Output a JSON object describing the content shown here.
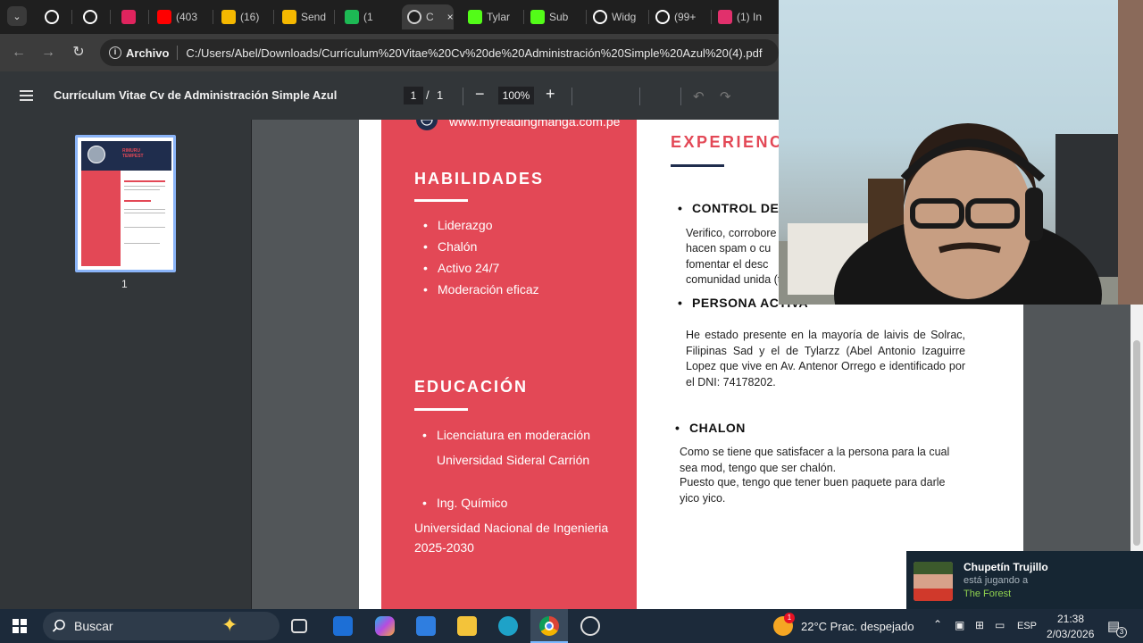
{
  "browser": {
    "tabs": [
      {
        "label": "",
        "icon": "github-icon",
        "color": "#ffffff"
      },
      {
        "label": "",
        "icon": "github-icon",
        "color": "#ffffff"
      },
      {
        "label": "",
        "icon": "app-icon",
        "color": "#e0245e"
      },
      {
        "label": "(403",
        "icon": "youtube-icon",
        "color": "#ff0000"
      },
      {
        "label": "(16)",
        "icon": "hand-icon",
        "color": "#f5b800"
      },
      {
        "label": "Send",
        "icon": "hand-icon",
        "color": "#f5b800"
      },
      {
        "label": "(1",
        "icon": "app-icon",
        "color": "#1db954"
      },
      {
        "label": "C",
        "icon": "chrome-icon",
        "color": "#cfcfcf"
      },
      {
        "label": "Tylar",
        "icon": "kick-icon",
        "color": "#53fc18"
      },
      {
        "label": "Sub",
        "icon": "kick-icon",
        "color": "#53fc18"
      },
      {
        "label": "Widg",
        "icon": "diamond-icon",
        "color": "#ffffff"
      },
      {
        "label": "(99+",
        "icon": "tiktok-icon",
        "color": "#ffffff"
      },
      {
        "label": "(1) In",
        "icon": "instagram-icon",
        "color": "#e1306c"
      }
    ],
    "omnibox_chip": "Archivo",
    "url": "C:/Users/Abel/Downloads/Currículum%20Vitae%20Cv%20de%20Administración%20Simple%20Azul%20(4).pdf"
  },
  "pdf_toolbar": {
    "title": "Currículum Vitae Cv de Administración Simple Azul",
    "page_current": "1",
    "page_sep": "/",
    "page_total": "1",
    "zoom": "100%",
    "zoom_out": "−",
    "zoom_in": "+"
  },
  "sidebar": {
    "thumb_name": "RIMURU TEMPEST",
    "thumb_page": "1"
  },
  "resume": {
    "website": "www.myreadingmanga.com.pe",
    "skills_heading": "HABILIDADES",
    "skills": [
      "Liderazgo",
      "Chalón",
      "Activo 24/7",
      "Moderación eficaz"
    ],
    "education_heading": "EDUCACIÓN",
    "edu1_title": "Licenciatura en moderación",
    "edu1_school": "Universidad Sideral Carrión",
    "edu2_title": "Ing. Químico",
    "edu2_school": "Universidad Nacional de Ingenieria",
    "edu2_years": "2025-2030",
    "experience_heading": "EXPERIENC",
    "exp1_title": "CONTROL DE",
    "exp1_lines": [
      "Verifico, corrobore",
      "hacen spam o cu",
      "fomentar el desc",
      "comunidad unida (t"
    ],
    "exp2_title": "PERSONA ACTIVA",
    "exp2_text": "He estado presente en la mayoría de laivis de Solrac, Filipinas Sad y el de Tylarzz (Abel Antonio Izaguirre Lopez que vive en Av. Antenor Orrego e identificado por el DNI: 74178202.",
    "exp3_title": "CHALON",
    "exp3_text1": "Como se tiene que satisfacer a la persona para la cual sea mod, tengo que ser chalón.",
    "exp3_text2": "Puesto que, tengo que tener buen paquete para darle yico yico."
  },
  "notification": {
    "name": "Chupetín Trujillo",
    "status": "está jugando a",
    "game": "The Forest"
  },
  "taskbar": {
    "search_label": "Buscar",
    "weather_badge": "1",
    "weather": "22°C  Prac. despejado",
    "lang": "ESP",
    "time": "21:38",
    "date": "2/03/2026",
    "notif_count": "3"
  },
  "colors": {
    "accent_red": "#e34856",
    "navy": "#1f2d4d",
    "chrome_blue": "#8ab4f8"
  }
}
